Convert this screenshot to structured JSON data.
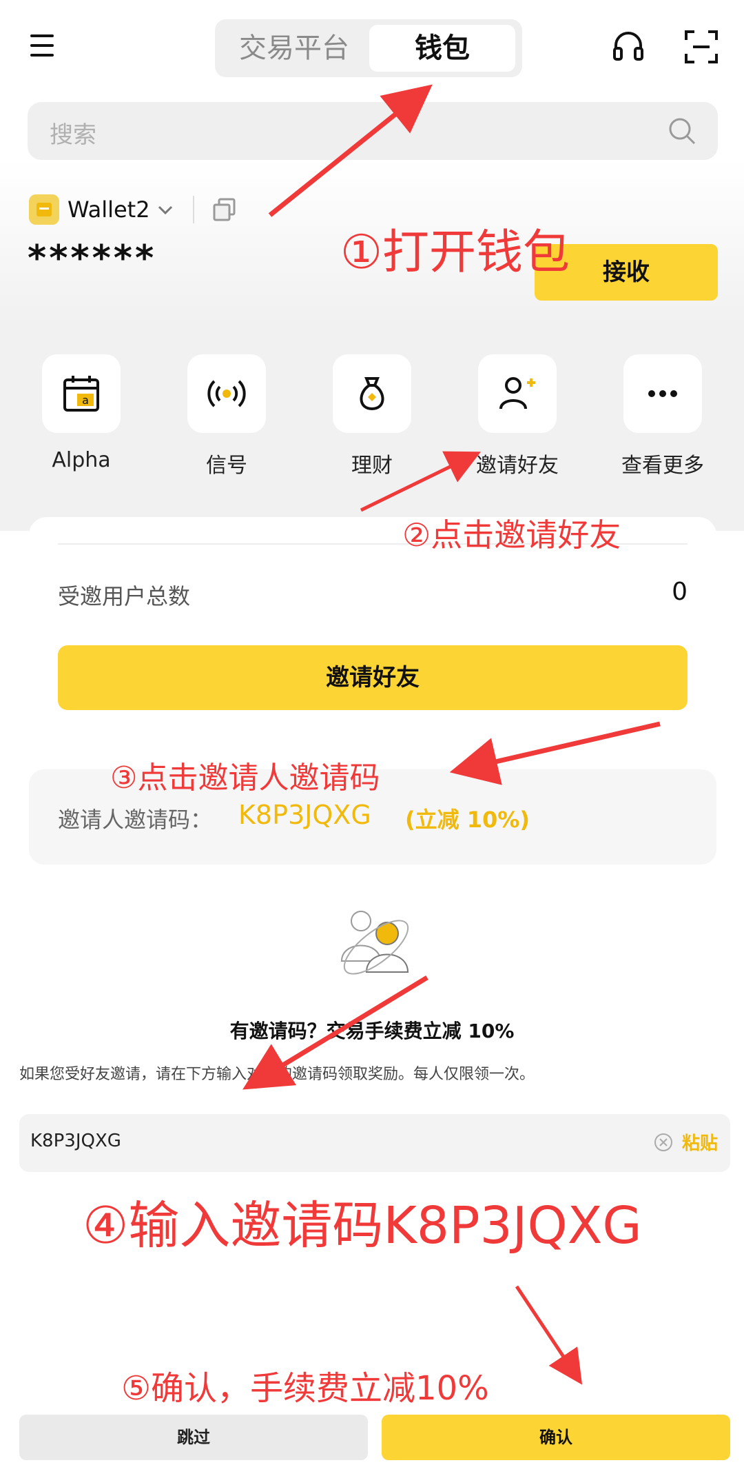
{
  "header": {
    "tabs": [
      {
        "label": "交易平台",
        "active": false
      },
      {
        "label": "钱包",
        "active": true
      }
    ],
    "icons": [
      "menu-icon",
      "headset-icon",
      "scan-icon"
    ]
  },
  "search": {
    "placeholder": "搜索"
  },
  "wallet": {
    "name": "Wallet2",
    "balance": "******",
    "receive_label": "接收"
  },
  "quick_actions": [
    {
      "label": "Alpha",
      "icon": "alpha-calendar-icon"
    },
    {
      "label": "信号",
      "icon": "signal-icon"
    },
    {
      "label": "理财",
      "icon": "money-bag-icon"
    },
    {
      "label": "邀请好友",
      "icon": "invite-user-icon"
    },
    {
      "label": "查看更多",
      "icon": "more-icon"
    }
  ],
  "referral_card": {
    "total_label": "受邀用户总数",
    "total_value": "0",
    "invite_button": "邀请好友"
  },
  "inviter_code": {
    "label": "邀请人邀请码：",
    "code": "K8P3JQXG",
    "promo": "(立减 10%)"
  },
  "promo": {
    "title": "有邀请码？交易手续费立减 10%",
    "description": "如果您受好友邀请，请在下方输入对方的邀请码领取奖励。每人仅限领一次。"
  },
  "referral_input": {
    "value": "K8P3JQXG",
    "paste_label": "粘贴"
  },
  "footer": {
    "skip_label": "跳过",
    "confirm_label": "确认"
  },
  "annotations": {
    "step1": "①打开钱包",
    "step2": "②点击邀请好友",
    "step3": "③点击邀请人邀请码",
    "step4": "④输入邀请码K8P3JQXG",
    "step5": "⑤确认，手续费立减10%"
  },
  "colors": {
    "accent": "#fcd535",
    "annotation": "#f03a3a",
    "code_text": "#f0b90b"
  }
}
